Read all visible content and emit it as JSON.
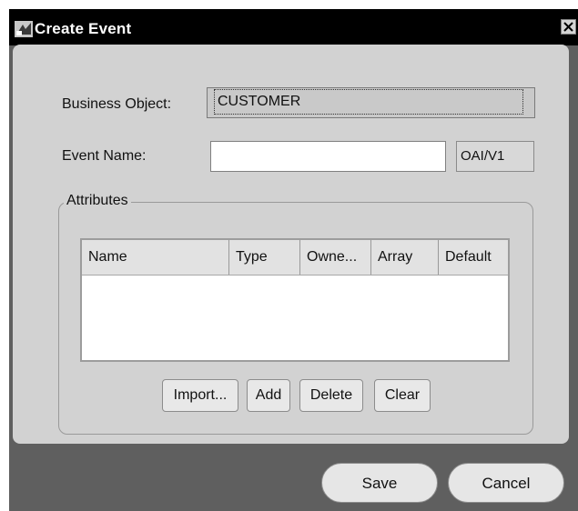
{
  "window": {
    "title": "Create Event"
  },
  "form": {
    "business_object": {
      "label": "Business Object:",
      "value": "CUSTOMER"
    },
    "event_name": {
      "label": "Event Name:",
      "value": "",
      "placeholder": ""
    },
    "version": "OAI/V1"
  },
  "attributes": {
    "legend": "Attributes",
    "columns": [
      "Name",
      "Type",
      "Owne...",
      "Array",
      "Default"
    ],
    "rows": []
  },
  "buttons": {
    "import": "Import...",
    "add": "Add",
    "delete": "Delete",
    "clear": "Clear",
    "save": "Save",
    "cancel": "Cancel"
  },
  "icons": {
    "app": "app-icon",
    "close": "close-icon"
  },
  "colors": {
    "titlebar": "#000000",
    "frame": "#5f5f5f",
    "panel": "#d2d2d2"
  }
}
